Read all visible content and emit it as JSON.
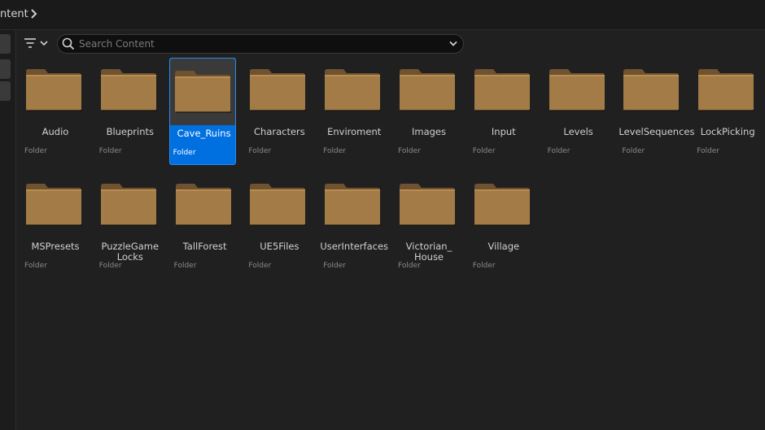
{
  "breadcrumb": {
    "current": "ntent"
  },
  "search": {
    "placeholder": "Search Content"
  },
  "colors": {
    "accent": "#0070e0",
    "folder": "#a37b46",
    "background": "#202020"
  },
  "items": [
    {
      "name": "Audio",
      "type": "Folder",
      "selected": false
    },
    {
      "name": "Blueprints",
      "type": "Folder",
      "selected": false
    },
    {
      "name": "Cave_Ruins",
      "type": "Folder",
      "selected": true
    },
    {
      "name": "Characters",
      "type": "Folder",
      "selected": false
    },
    {
      "name": "Enviroment",
      "type": "Folder",
      "selected": false
    },
    {
      "name": "Images",
      "type": "Folder",
      "selected": false
    },
    {
      "name": "Input",
      "type": "Folder",
      "selected": false
    },
    {
      "name": "Levels",
      "type": "Folder",
      "selected": false
    },
    {
      "name": "LevelSequences",
      "type": "Folder",
      "selected": false
    },
    {
      "name": "LockPicking",
      "type": "Folder",
      "selected": false
    },
    {
      "name": "MSPresets",
      "type": "Folder",
      "selected": false
    },
    {
      "name": "PuzzleGame\nLocks",
      "type": "Folder",
      "selected": false
    },
    {
      "name": "TallForest",
      "type": "Folder",
      "selected": false
    },
    {
      "name": "UE5Files",
      "type": "Folder",
      "selected": false
    },
    {
      "name": "UserInterfaces",
      "type": "Folder",
      "selected": false
    },
    {
      "name": "Victorian_\nHouse",
      "type": "Folder",
      "selected": false
    },
    {
      "name": "Village",
      "type": "Folder",
      "selected": false
    }
  ]
}
